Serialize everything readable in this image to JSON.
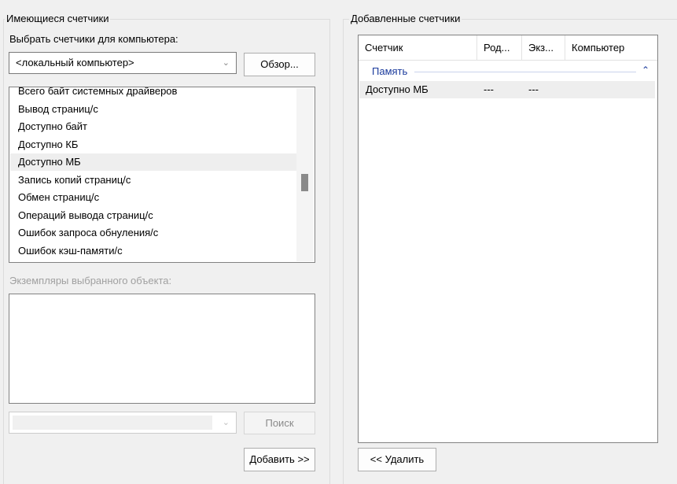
{
  "available": {
    "group_title": "Имеющиеся счетчики",
    "select_label": "Выбрать счетчики для компьютера:",
    "computer_value": "<локальный компьютер>",
    "browse_label": "Обзор...",
    "counters": [
      "Всего байт системных драйверов",
      "Вывод страниц/с",
      "Доступно байт",
      "Доступно КБ",
      "Доступно МБ",
      "Запись копий страниц/с",
      "Обмен страниц/с",
      "Операций вывода страниц/с",
      "Ошибок запроса обнуления/с",
      "Ошибок кэш-памяти/с"
    ],
    "selected_counter": "Доступно МБ",
    "instances_label": "Экземпляры выбранного объекта:",
    "search_label": "Поиск",
    "add_label": "Добавить >>"
  },
  "added": {
    "group_title": "Добавленные счетчики",
    "columns": [
      "Счетчик",
      "Род...",
      "Экз...",
      "Компьютер"
    ],
    "group_name": "Память",
    "rows": [
      {
        "counter": "Доступно МБ",
        "parent": "---",
        "instance": "---",
        "computer": ""
      }
    ],
    "remove_label": "<< Удалить"
  },
  "icons": {
    "combo_chevron": "chevron-down-icon",
    "group_chevron": "chevron-up-icon"
  },
  "scroll_position": 0.55
}
